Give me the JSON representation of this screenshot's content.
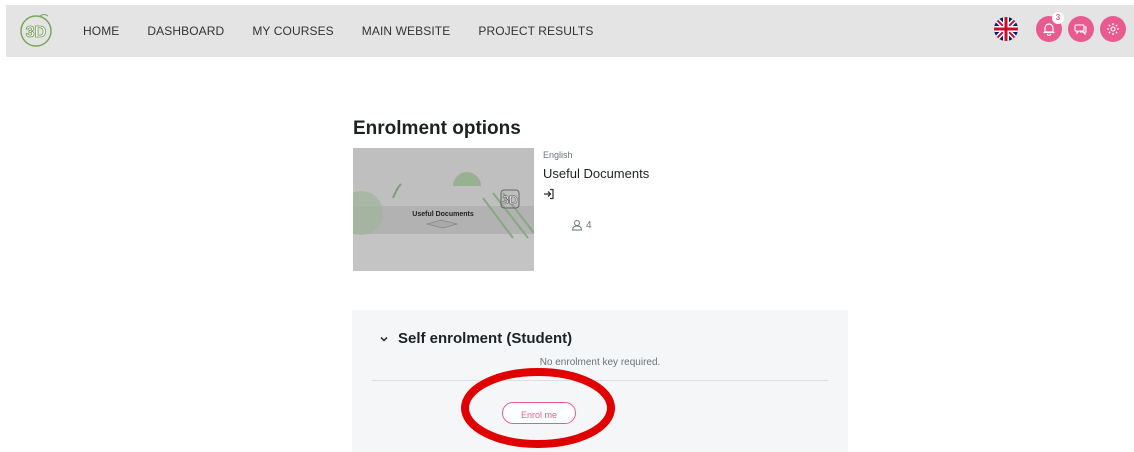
{
  "navbar": {
    "logo_label": "3D",
    "links": [
      {
        "label": "HOME"
      },
      {
        "label": "DASHBOARD"
      },
      {
        "label": "MY COURSES"
      },
      {
        "label": "MAIN WEBSITE"
      },
      {
        "label": "PROJECT RESULTS"
      }
    ],
    "notification_count": "3",
    "icons": [
      "uk-flag-icon",
      "bell-icon",
      "chat-icon",
      "gear-icon"
    ]
  },
  "page": {
    "title": "Enrolment options"
  },
  "course": {
    "image_caption": "Useful Documents",
    "language": "English",
    "name": "Useful Documents",
    "participants": "4"
  },
  "enrolment": {
    "title": "Self enrolment (Student)",
    "note": "No enrolment key required.",
    "button_label": "Enrol me"
  },
  "colors": {
    "accent": "#e95b8f",
    "annotation": "#e00000",
    "navbar_bg": "#e4e4e4"
  }
}
